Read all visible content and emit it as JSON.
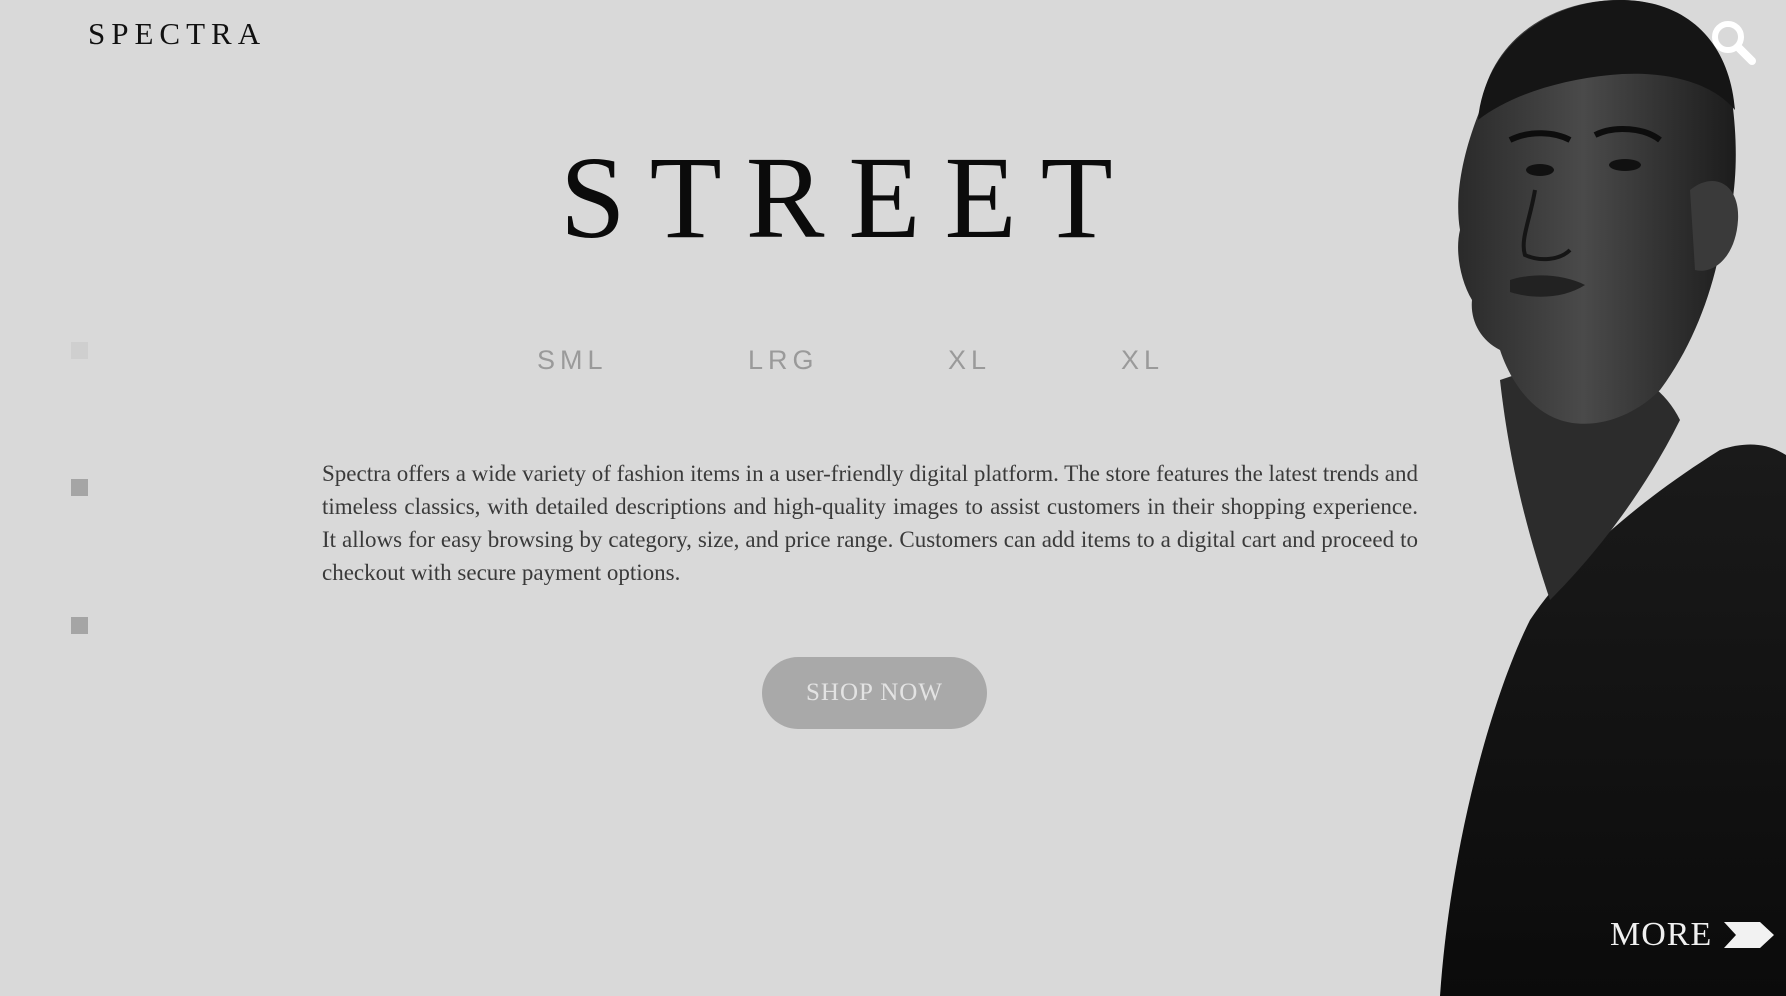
{
  "brand": {
    "logo_text": "SPECTRA"
  },
  "header": {
    "search_icon": "search-icon"
  },
  "hero": {
    "title": "STREET",
    "sizes": [
      "SML",
      "LRG",
      "XL",
      "XL"
    ],
    "description": " Spectra offers a wide variety of fashion items in a user-friendly digital platform. The store features the latest trends and timeless classics, with detailed descriptions and high-quality images to assist customers in their shopping experience. It allows for easy browsing by category, size, and price range. Customers can add items to a digital cart and proceed to checkout with secure payment options.",
    "cta_label": "SHOP NOW"
  },
  "slider_dots": {
    "count": 3,
    "active_index": 0
  },
  "footer": {
    "more_label": "MORE",
    "more_icon": "arrow-right-icon"
  },
  "colors": {
    "background": "#d9d9d9",
    "title": "#0b0b0b",
    "size_text": "#9a9a9a",
    "button_bg": "#a9a9a9",
    "dot_active": "#cfcfcf",
    "dot_inactive": "#a5a5a5"
  }
}
